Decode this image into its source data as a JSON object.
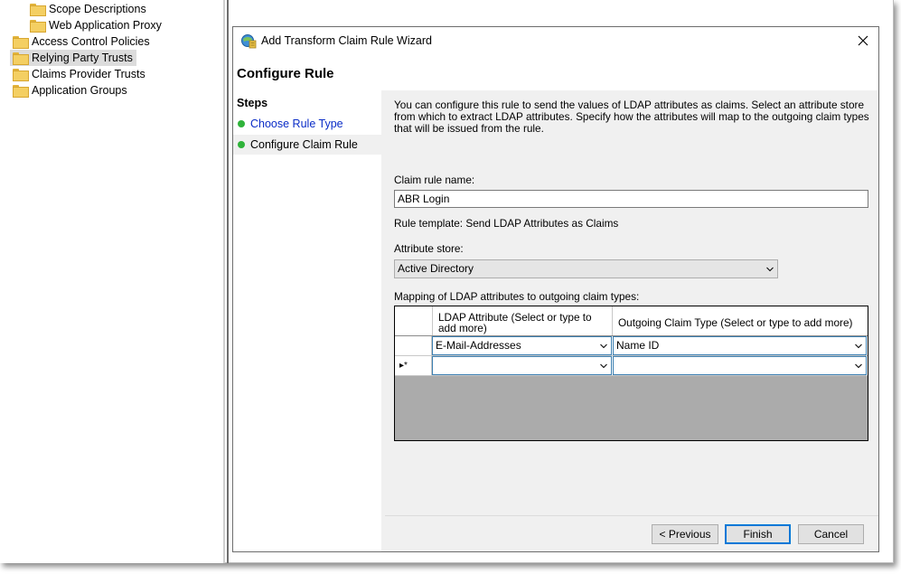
{
  "tree": {
    "items": [
      {
        "label": "Scope Descriptions"
      },
      {
        "label": "Web Application Proxy"
      },
      {
        "label": "Access Control Policies"
      },
      {
        "label": "Relying Party Trusts"
      },
      {
        "label": "Claims Provider Trusts"
      },
      {
        "label": "Application Groups"
      }
    ]
  },
  "dialog": {
    "title": "Add Transform Claim Rule Wizard",
    "page_title": "Configure Rule",
    "steps_title": "Steps",
    "steps": [
      {
        "label": "Choose Rule Type"
      },
      {
        "label": "Configure Claim Rule"
      }
    ],
    "description": "You can configure this rule to send the values of LDAP attributes as claims. Select an attribute store from which to extract LDAP attributes. Specify how the attributes will map to the outgoing claim types that will be issued from the rule.",
    "rule_name_label": "Claim rule name:",
    "rule_name_value": "ABR Login",
    "rule_template": "Rule template: Send LDAP Attributes as Claims",
    "attr_store_label": "Attribute store:",
    "attr_store_value": "Active Directory",
    "mapping_label": "Mapping of LDAP attributes to outgoing claim types:",
    "grid": {
      "col_ldap": "LDAP Attribute (Select or type to add more)",
      "col_claim": "Outgoing Claim Type (Select or type to add more)",
      "rows": [
        {
          "marker": "",
          "ldap": "E-Mail-Addresses",
          "claim": "Name ID"
        },
        {
          "marker": "▸*",
          "ldap": "",
          "claim": ""
        }
      ]
    },
    "buttons": {
      "previous": "< Previous",
      "finish": "Finish",
      "cancel": "Cancel"
    }
  },
  "colors": {
    "link": "#0a2cc7",
    "step_dot": "#2fb33a",
    "focus_border": "#0078d7"
  }
}
